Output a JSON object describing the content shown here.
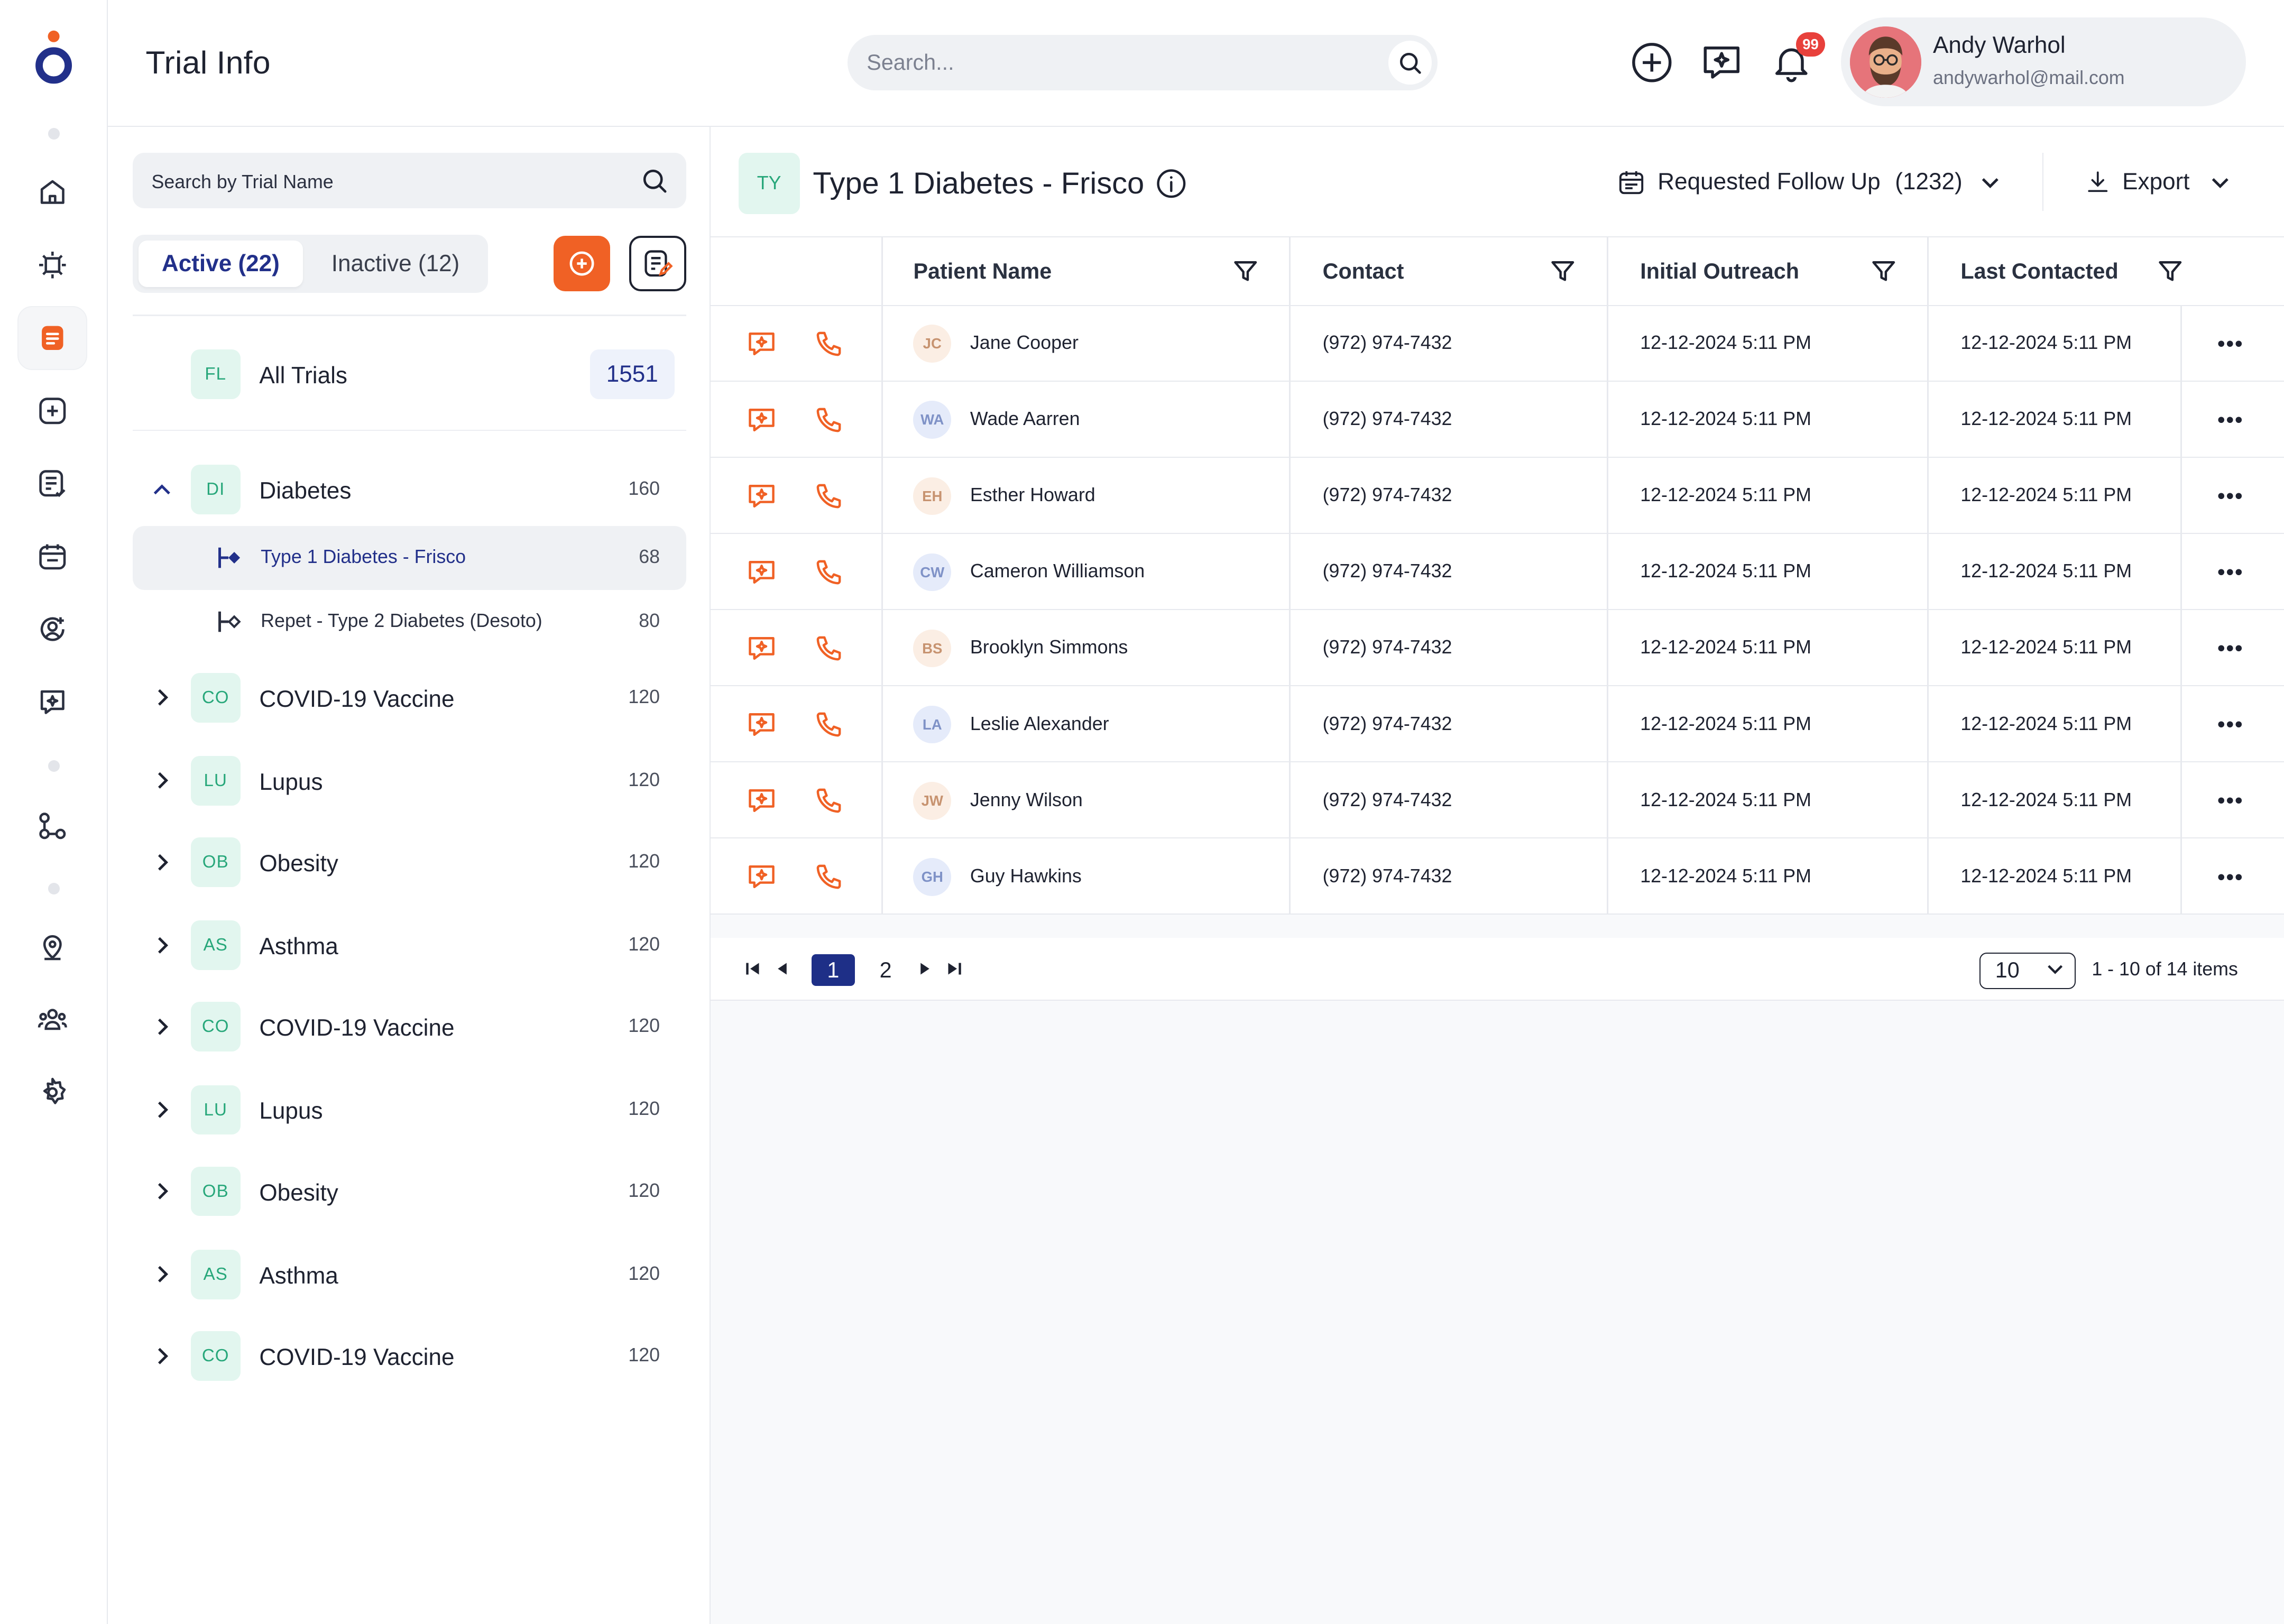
{
  "app": {
    "title": "Trial Info"
  },
  "search": {
    "placeholder": "Search..."
  },
  "notifications": {
    "count": "99"
  },
  "user": {
    "name": "Andy Warhol",
    "email": "andywarhol@mail.com"
  },
  "sidebar": {
    "items": [
      {
        "name": "home-icon"
      },
      {
        "name": "bug-icon"
      },
      {
        "name": "document-icon",
        "active": true
      },
      {
        "name": "plus-square-icon"
      },
      {
        "name": "checklist-icon"
      },
      {
        "name": "calendar-icon"
      },
      {
        "name": "user-circle-icon"
      },
      {
        "name": "ai-chat-icon"
      },
      {
        "name": "workflow-icon"
      },
      {
        "name": "location-icon"
      },
      {
        "name": "team-icon"
      },
      {
        "name": "settings-icon"
      }
    ]
  },
  "trials": {
    "search_placeholder": "Search by Trial Name",
    "tabs": {
      "active": "Active (22)",
      "inactive": "Inactive (12)"
    },
    "all": {
      "tag": "FL",
      "label": "All Trials",
      "count": "1551"
    },
    "groups": [
      {
        "tag": "DI",
        "label": "Diabetes",
        "count": "160",
        "expanded": true
      },
      {
        "tag": "CO",
        "label": "COVID-19 Vaccine",
        "count": "120"
      },
      {
        "tag": "LU",
        "label": "Lupus",
        "count": "120"
      },
      {
        "tag": "OB",
        "label": "Obesity",
        "count": "120"
      },
      {
        "tag": "AS",
        "label": "Asthma",
        "count": "120"
      },
      {
        "tag": "CO",
        "label": "COVID-19 Vaccine",
        "count": "120"
      },
      {
        "tag": "LU",
        "label": "Lupus",
        "count": "120"
      },
      {
        "tag": "OB",
        "label": "Obesity",
        "count": "120"
      },
      {
        "tag": "AS",
        "label": "Asthma",
        "count": "120"
      },
      {
        "tag": "CO",
        "label": "COVID-19 Vaccine",
        "count": "120"
      }
    ],
    "subitems": [
      {
        "label": "Type 1 Diabetes - Frisco",
        "count": "68",
        "selected": true
      },
      {
        "label": "Repet - Type 2 Diabetes (Desoto)",
        "count": "80"
      }
    ]
  },
  "main": {
    "tag": "TY",
    "title": "Type 1 Diabetes - Frisco",
    "filter_label": "Requested Follow Up",
    "filter_count": "(1232)",
    "export_label": "Export"
  },
  "table": {
    "columns": [
      "Patient Name",
      "Contact",
      "Initial Outreach",
      "Last Contacted"
    ],
    "rows": [
      {
        "initials": "JC",
        "name": "Jane Cooper",
        "contact": "(972) 974-7432",
        "initial": "12-12-2024 5:11 PM",
        "last": "12-12-2024 5:11 PM",
        "bg": "#fbeee4",
        "fg": "#c79370"
      },
      {
        "initials": "WA",
        "name": "Wade Aarren",
        "contact": "(972) 974-7432",
        "initial": "12-12-2024 5:11 PM",
        "last": "12-12-2024 5:11 PM",
        "bg": "#e5ebfa",
        "fg": "#7f92c7"
      },
      {
        "initials": "EH",
        "name": "Esther Howard",
        "contact": "(972) 974-7432",
        "initial": "12-12-2024 5:11 PM",
        "last": "12-12-2024 5:11 PM",
        "bg": "#fbeee4",
        "fg": "#c79370"
      },
      {
        "initials": "CW",
        "name": "Cameron Williamson",
        "contact": "(972) 974-7432",
        "initial": "12-12-2024 5:11 PM",
        "last": "12-12-2024 5:11 PM",
        "bg": "#e5ebfa",
        "fg": "#7f92c7"
      },
      {
        "initials": "BS",
        "name": "Brooklyn Simmons",
        "contact": "(972) 974-7432",
        "initial": "12-12-2024 5:11 PM",
        "last": "12-12-2024 5:11 PM",
        "bg": "#fbeee4",
        "fg": "#c79370"
      },
      {
        "initials": "LA",
        "name": "Leslie Alexander",
        "contact": "(972) 974-7432",
        "initial": "12-12-2024 5:11 PM",
        "last": "12-12-2024 5:11 PM",
        "bg": "#e5ebfa",
        "fg": "#7f92c7"
      },
      {
        "initials": "JW",
        "name": "Jenny Wilson",
        "contact": "(972) 974-7432",
        "initial": "12-12-2024 5:11 PM",
        "last": "12-12-2024 5:11 PM",
        "bg": "#fbeee4",
        "fg": "#c79370"
      },
      {
        "initials": "GH",
        "name": "Guy Hawkins",
        "contact": "(972) 974-7432",
        "initial": "12-12-2024 5:11 PM",
        "last": "12-12-2024 5:11 PM",
        "bg": "#e5ebfa",
        "fg": "#7f92c7"
      }
    ]
  },
  "pagination": {
    "pages": [
      "1",
      "2"
    ],
    "current": "1",
    "page_size": "10",
    "range": "1 - 10 of 14 items"
  },
  "colors": {
    "accent": "#f06125",
    "brand": "#1e2f87",
    "tag_bg": "#e2f6ef",
    "tag_fg": "#27a77a"
  }
}
